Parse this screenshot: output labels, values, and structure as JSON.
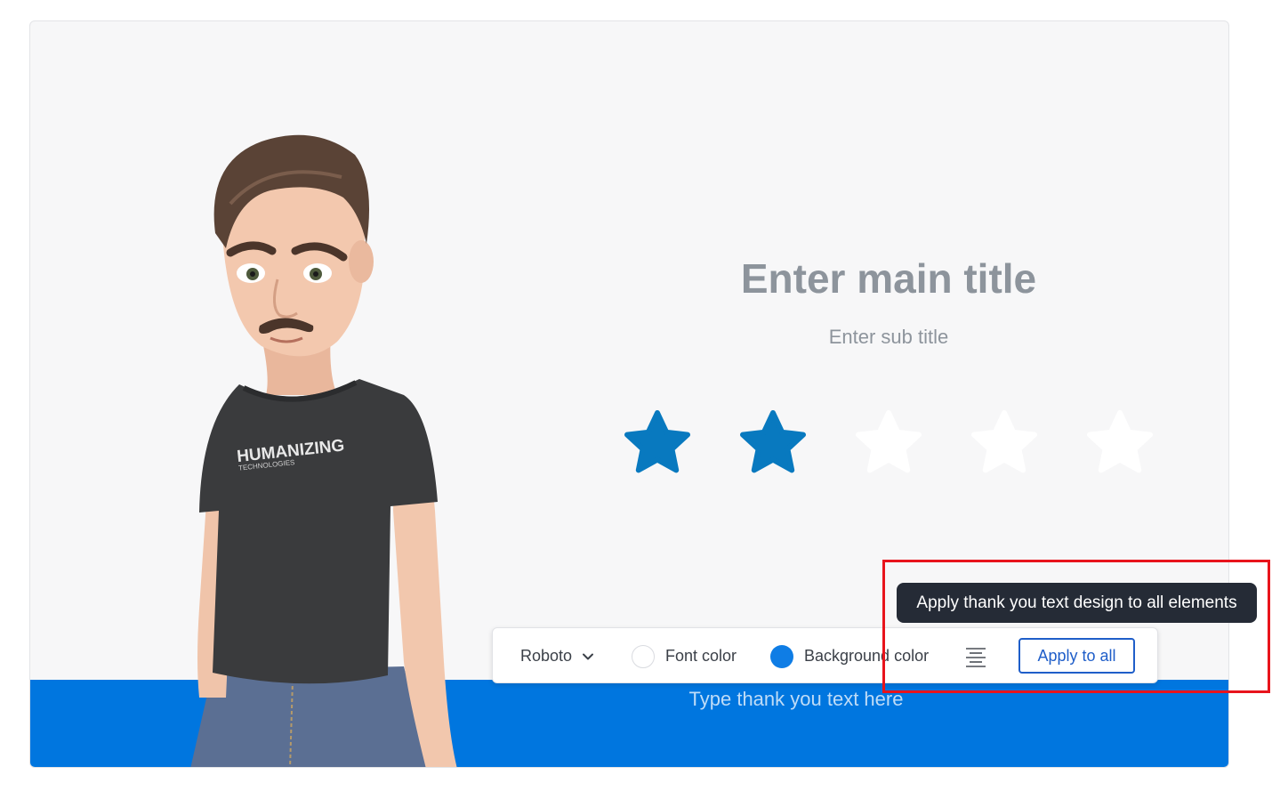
{
  "slide": {
    "main_title": "Enter main title",
    "sub_title": "Enter sub title",
    "thank_you_text": "Type thank you text here",
    "avatar_shirt_text": "HUMANIZING",
    "avatar_shirt_subtext": "TECHNOLOGIES"
  },
  "rating": {
    "value": 2,
    "max": 5,
    "filled_color": "#0879bf",
    "empty_color": "#ffffff"
  },
  "toolbar": {
    "font_family": "Roboto",
    "font_color_label": "Font color",
    "font_color_value": "#ffffff",
    "background_color_label": "Background color",
    "background_color_value": "#0f7de5",
    "align_icon": "align-center-icon",
    "apply_label": "Apply to all"
  },
  "tooltip": {
    "text": "Apply thank you text design to all elements"
  },
  "colors": {
    "band": "#0076df",
    "highlight": "#e8141c",
    "accent": "#1f5ec9"
  }
}
